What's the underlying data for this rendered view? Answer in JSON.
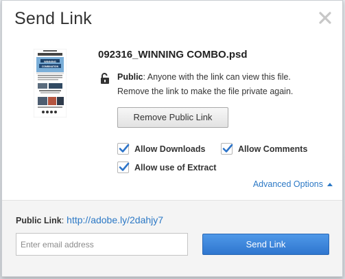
{
  "dialog": {
    "title": "Send Link",
    "close_icon": "close-icon"
  },
  "file": {
    "name": "092316_WINNING COMBO.psd",
    "thumbnail_icon": "file-thumbnail",
    "thumbnail_text": "WINNING COMBINATION"
  },
  "access": {
    "lock_icon": "unlocked-padlock-icon",
    "label": "Public",
    "description": ": Anyone with the link can view this file. Remove the link to make the file private again."
  },
  "buttons": {
    "remove_public_link": "Remove Public Link",
    "send_link": "Send Link"
  },
  "options": {
    "allow_downloads": {
      "label": "Allow Downloads",
      "checked": true
    },
    "allow_comments": {
      "label": "Allow Comments",
      "checked": true
    },
    "allow_extract": {
      "label": "Allow use of Extract",
      "checked": true
    }
  },
  "advanced_options": {
    "label": "Advanced Options",
    "icon": "caret-up-icon"
  },
  "footer": {
    "public_link_label": "Public Link",
    "public_link_separator": ":",
    "public_link_url": "http://adobe.ly/2dahjy7",
    "email_placeholder": "Enter email address",
    "email_value": ""
  },
  "colors": {
    "accent": "#2b78c5",
    "checkbox_blue": "#2d74c9",
    "send_button": "#3a82d8"
  }
}
